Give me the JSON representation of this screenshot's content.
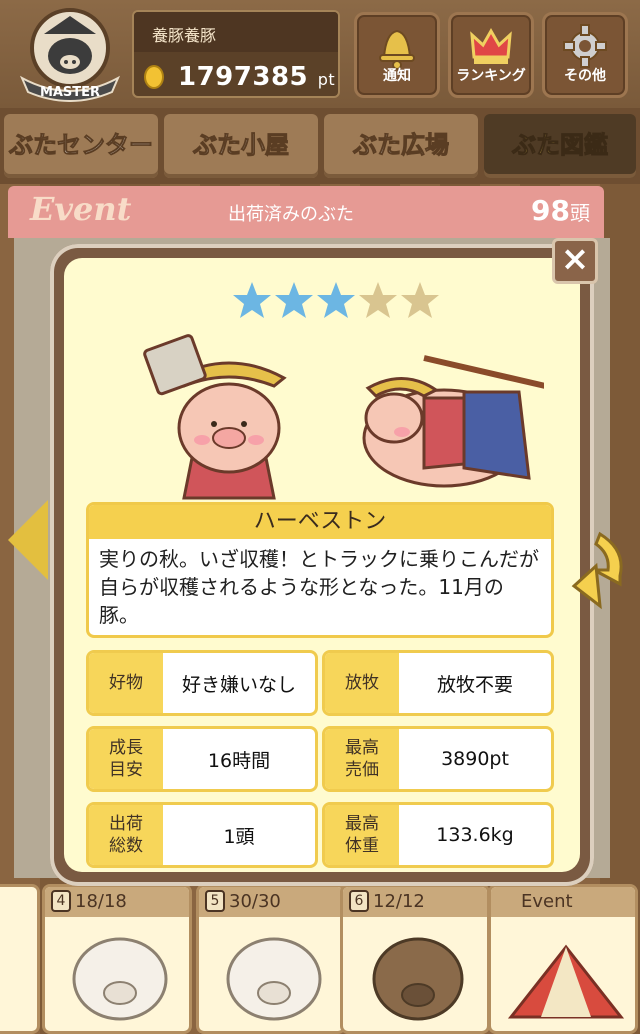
{
  "header": {
    "user_name": "養豚養豚",
    "points_value": "1797385",
    "points_unit": "pt",
    "badge_text": "MASTER",
    "buttons": [
      {
        "label": "通知",
        "icon": "bell-icon"
      },
      {
        "label": "ランキング",
        "icon": "crown-icon"
      },
      {
        "label": "その他",
        "icon": "gear-icon"
      }
    ]
  },
  "nav": {
    "tabs": [
      {
        "label": "ぶたセンター",
        "active": false
      },
      {
        "label": "ぶた小屋",
        "active": false
      },
      {
        "label": "ぶた広場",
        "active": false
      },
      {
        "label": "ぶた図鑑",
        "active": true
      }
    ]
  },
  "event_bar": {
    "event_label": "Event",
    "shipped_label": "出荷済みのぶた",
    "count": "98",
    "count_unit": "頭"
  },
  "modal": {
    "close_label": "×",
    "rating": 3,
    "rating_max": 5,
    "name": "ハーベストン",
    "description": "実りの秋。いざ収穫！とトラックに乗りこんだが自らが収穫されるような形となった。11月の豚。",
    "stats": [
      {
        "key": "好物",
        "value": "好き嫌いなし"
      },
      {
        "key": "放牧",
        "value": "放牧不要"
      },
      {
        "key": "成長\n目安",
        "value": "16時間"
      },
      {
        "key": "最高\n売価",
        "value": "3890pt"
      },
      {
        "key": "出荷\n総数",
        "value": "1頭"
      },
      {
        "key": "最高\n体重",
        "value": "133.6kg"
      }
    ]
  },
  "bottom_cards": [
    {
      "no": "4",
      "count": "18/18"
    },
    {
      "no": "5",
      "count": "30/30"
    },
    {
      "no": "6",
      "count": "12/12"
    },
    {
      "no": "",
      "count": "Event"
    }
  ],
  "colors": {
    "star_on": "#6cb6e3",
    "star_off": "#d9c590",
    "accent_yellow": "#f5d04e"
  }
}
